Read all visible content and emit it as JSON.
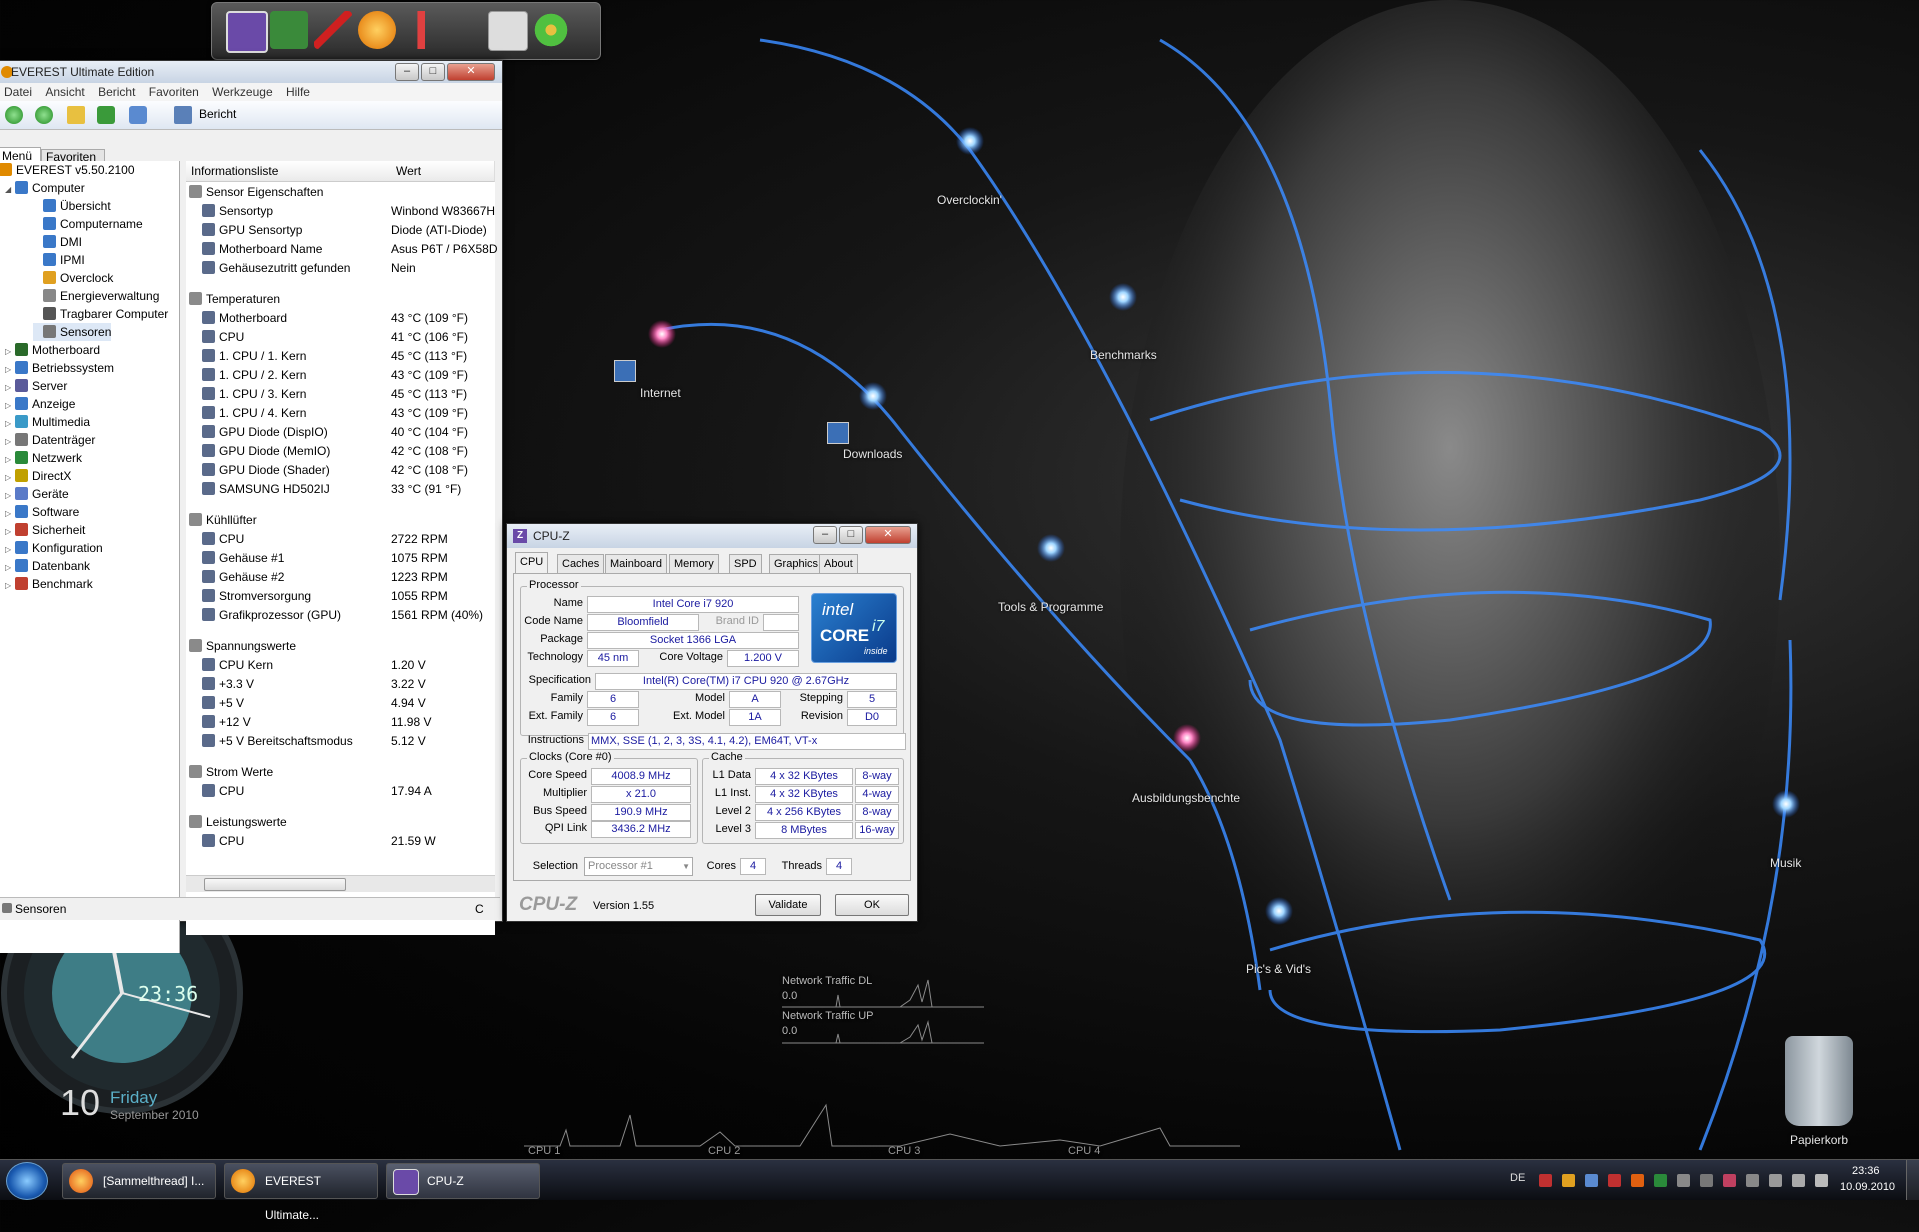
{
  "desktop": {
    "icons": [
      {
        "label": "Overclockin'"
      },
      {
        "label": "Benchmarks"
      },
      {
        "label": "Internet"
      },
      {
        "label": "Downloads"
      },
      {
        "label": "Tools & Programme"
      },
      {
        "label": "Ausbildungsbenchte"
      },
      {
        "label": "Musik"
      },
      {
        "label": "Pic's & Vid's"
      },
      {
        "label": "Papierkorb"
      }
    ],
    "network": {
      "dl_label": "Network Traffic DL",
      "dl_value": "0.0",
      "up_label": "Network Traffic UP",
      "up_value": "0.0"
    },
    "cpu_meter": {
      "labels": [
        "CPU 1",
        "CPU 2",
        "CPU 3",
        "CPU 4"
      ]
    },
    "clock": {
      "time": "23:36",
      "day_num": "10",
      "weekday": "Friday",
      "month_year": "September 2010"
    }
  },
  "everest": {
    "title": "EVEREST Ultimate Edition",
    "menu": [
      "Datei",
      "Ansicht",
      "Bericht",
      "Favoriten",
      "Werkzeuge",
      "Hilfe"
    ],
    "toolbar": {
      "report_label": "Bericht"
    },
    "panel_tabs": [
      "Menü",
      "Favoriten"
    ],
    "tree": [
      {
        "label": "EVEREST v5.50.2100",
        "indent": 0,
        "color": "#e08a00"
      },
      {
        "label": "Computer",
        "indent": 1,
        "color": "#3a78c8",
        "exp": "◢"
      },
      {
        "label": "Übersicht",
        "indent": 2,
        "color": "#3a78c8"
      },
      {
        "label": "Computername",
        "indent": 2,
        "color": "#3a78c8"
      },
      {
        "label": "DMI",
        "indent": 2,
        "color": "#3a78c8"
      },
      {
        "label": "IPMI",
        "indent": 2,
        "color": "#3a78c8"
      },
      {
        "label": "Overclock",
        "indent": 2,
        "color": "#e0a020"
      },
      {
        "label": "Energieverwaltung",
        "indent": 2,
        "color": "#888"
      },
      {
        "label": "Tragbarer Computer",
        "indent": 2,
        "color": "#555"
      },
      {
        "label": "Sensoren",
        "indent": 2,
        "color": "#777"
      },
      {
        "label": "Motherboard",
        "indent": 1,
        "color": "#2a6a2a",
        "exp": "▷"
      },
      {
        "label": "Betriebssystem",
        "indent": 1,
        "color": "#3a78c8",
        "exp": "▷"
      },
      {
        "label": "Server",
        "indent": 1,
        "color": "#5a5a9a",
        "exp": "▷"
      },
      {
        "label": "Anzeige",
        "indent": 1,
        "color": "#3a78c8",
        "exp": "▷"
      },
      {
        "label": "Multimedia",
        "indent": 1,
        "color": "#3a9ac8",
        "exp": "▷"
      },
      {
        "label": "Datenträger",
        "indent": 1,
        "color": "#777",
        "exp": "▷"
      },
      {
        "label": "Netzwerk",
        "indent": 1,
        "color": "#2a8a3a",
        "exp": "▷"
      },
      {
        "label": "DirectX",
        "indent": 1,
        "color": "#c0a000",
        "exp": "▷"
      },
      {
        "label": "Geräte",
        "indent": 1,
        "color": "#5a7ac8",
        "exp": "▷"
      },
      {
        "label": "Software",
        "indent": 1,
        "color": "#3a78c8",
        "exp": "▷"
      },
      {
        "label": "Sicherheit",
        "indent": 1,
        "color": "#c04030",
        "exp": "▷"
      },
      {
        "label": "Konfiguration",
        "indent": 1,
        "color": "#3a78c8",
        "exp": "▷"
      },
      {
        "label": "Datenbank",
        "indent": 1,
        "color": "#3a78c8",
        "exp": "▷"
      },
      {
        "label": "Benchmark",
        "indent": 1,
        "color": "#c04030",
        "exp": "▷"
      }
    ],
    "columns": {
      "name": "Informationsliste",
      "value": "Wert"
    },
    "list": [
      {
        "type": "group",
        "name": "Sensor Eigenschaften"
      },
      {
        "name": "Sensortyp",
        "value": "Winbond W83667H"
      },
      {
        "name": "GPU Sensortyp",
        "value": "Diode  (ATI-Diode)"
      },
      {
        "name": "Motherboard Name",
        "value": "Asus P6T / P6X58D"
      },
      {
        "name": "Gehäusezutritt gefunden",
        "value": "Nein"
      },
      {
        "type": "gap"
      },
      {
        "type": "group",
        "name": "Temperaturen"
      },
      {
        "name": "Motherboard",
        "value": "43 °C  (109 °F)"
      },
      {
        "name": "CPU",
        "value": "41 °C  (106 °F)"
      },
      {
        "name": "1. CPU / 1. Kern",
        "value": "45 °C  (113 °F)"
      },
      {
        "name": "1. CPU / 2. Kern",
        "value": "43 °C  (109 °F)"
      },
      {
        "name": "1. CPU / 3. Kern",
        "value": "45 °C  (113 °F)"
      },
      {
        "name": "1. CPU / 4. Kern",
        "value": "43 °C  (109 °F)"
      },
      {
        "name": "GPU Diode (DispIO)",
        "value": "40 °C  (104 °F)"
      },
      {
        "name": "GPU Diode (MemIO)",
        "value": "42 °C  (108 °F)"
      },
      {
        "name": "GPU Diode (Shader)",
        "value": "42 °C  (108 °F)"
      },
      {
        "name": "SAMSUNG HD502IJ",
        "value": "33 °C  (91 °F)"
      },
      {
        "type": "gap"
      },
      {
        "type": "group",
        "name": "Kühllüfter"
      },
      {
        "name": "CPU",
        "value": "2722 RPM"
      },
      {
        "name": "Gehäuse #1",
        "value": "1075 RPM"
      },
      {
        "name": "Gehäuse #2",
        "value": "1223 RPM"
      },
      {
        "name": "Stromversorgung",
        "value": "1055 RPM"
      },
      {
        "name": "Grafikprozessor (GPU)",
        "value": "1561 RPM  (40%)"
      },
      {
        "type": "gap"
      },
      {
        "type": "group",
        "name": "Spannungswerte"
      },
      {
        "name": "CPU Kern",
        "value": "1.20 V"
      },
      {
        "name": "+3.3 V",
        "value": "3.22 V"
      },
      {
        "name": "+5 V",
        "value": "4.94 V"
      },
      {
        "name": "+12 V",
        "value": "11.98 V"
      },
      {
        "name": "+5 V Bereitschaftsmodus",
        "value": "5.12 V"
      },
      {
        "type": "gap"
      },
      {
        "type": "group",
        "name": "Strom Werte"
      },
      {
        "name": "CPU",
        "value": "17.94 A"
      },
      {
        "type": "gap"
      },
      {
        "type": "group",
        "name": "Leistungswerte"
      },
      {
        "name": "CPU",
        "value": "21.59 W"
      }
    ],
    "status": {
      "left": "Sensoren",
      "right": "C"
    }
  },
  "cpuz": {
    "title": "CPU-Z",
    "tabs": [
      "CPU",
      "Caches",
      "Mainboard",
      "Memory",
      "SPD",
      "Graphics",
      "About"
    ],
    "processor": {
      "group": "Processor",
      "name_label": "Name",
      "name": "Intel Core i7 920",
      "codename_label": "Code Name",
      "codename": "Bloomfield",
      "brand_label": "Brand ID",
      "package_label": "Package",
      "package": "Socket 1366 LGA",
      "technology_label": "Technology",
      "technology": "45 nm",
      "voltage_label": "Core Voltage",
      "voltage": "1.200 V",
      "spec_label": "Specification",
      "spec": "Intel(R) Core(TM) i7 CPU       920  @ 2.67GHz",
      "family_label": "Family",
      "family": "6",
      "model_label": "Model",
      "model": "A",
      "stepping_label": "Stepping",
      "stepping": "5",
      "extfamily_label": "Ext. Family",
      "extfamily": "6",
      "extmodel_label": "Ext. Model",
      "extmodel": "1A",
      "revision_label": "Revision",
      "revision": "D0",
      "instr_label": "Instructions",
      "instr": "MMX, SSE (1, 2, 3, 3S, 4.1, 4.2), EM64T, VT-x"
    },
    "logo": {
      "brand": "intel",
      "line": "CORE",
      "sub": "i7",
      "inside": "inside"
    },
    "clocks": {
      "group": "Clocks (Core #0)",
      "core_speed_label": "Core Speed",
      "core_speed": "4008.9 MHz",
      "multiplier_label": "Multiplier",
      "multiplier": "x 21.0",
      "bus_speed_label": "Bus Speed",
      "bus_speed": "190.9 MHz",
      "qpi_label": "QPI Link",
      "qpi": "3436.2 MHz"
    },
    "cache": {
      "group": "Cache",
      "rows": [
        {
          "label": "L1 Data",
          "size": "4 x 32 KBytes",
          "way": "8-way"
        },
        {
          "label": "L1 Inst.",
          "size": "4 x 32 KBytes",
          "way": "4-way"
        },
        {
          "label": "Level 2",
          "size": "4 x 256 KBytes",
          "way": "8-way"
        },
        {
          "label": "Level 3",
          "size": "8 MBytes",
          "way": "16-way"
        }
      ]
    },
    "selection_label": "Selection",
    "selection": "Processor #1",
    "cores_label": "Cores",
    "cores": "4",
    "threads_label": "Threads",
    "threads": "4",
    "footer": {
      "brand": "CPU-Z",
      "version": "Version 1.55",
      "validate": "Validate",
      "ok": "OK"
    }
  },
  "taskbar": {
    "tasks": [
      {
        "label": "[Sammelthread] I..."
      },
      {
        "label": "EVEREST Ultimate..."
      },
      {
        "label": "CPU-Z"
      }
    ],
    "lang": "DE",
    "time": "23:36",
    "date": "10.09.2010"
  }
}
